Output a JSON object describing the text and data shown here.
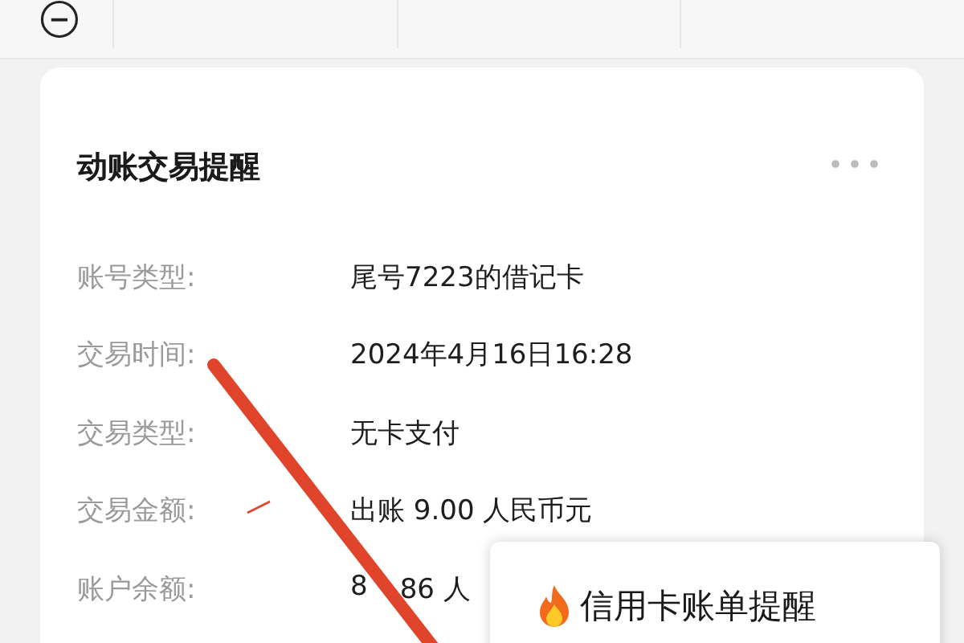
{
  "card": {
    "title": "动账交易提醒",
    "fields": [
      {
        "label": "账号类型:",
        "value": "尾号7223的借记卡"
      },
      {
        "label": "交易时间:",
        "value": "2024年4月16日16:28"
      },
      {
        "label": "交易类型:",
        "value": "无卡支付"
      },
      {
        "label": "交易金额:",
        "value": "出账 9.00 人民币元"
      },
      {
        "label": "账户余额:",
        "value": [
          "8",
          "86 人"
        ]
      }
    ]
  },
  "popup": {
    "text": "信用卡账单提醒"
  }
}
